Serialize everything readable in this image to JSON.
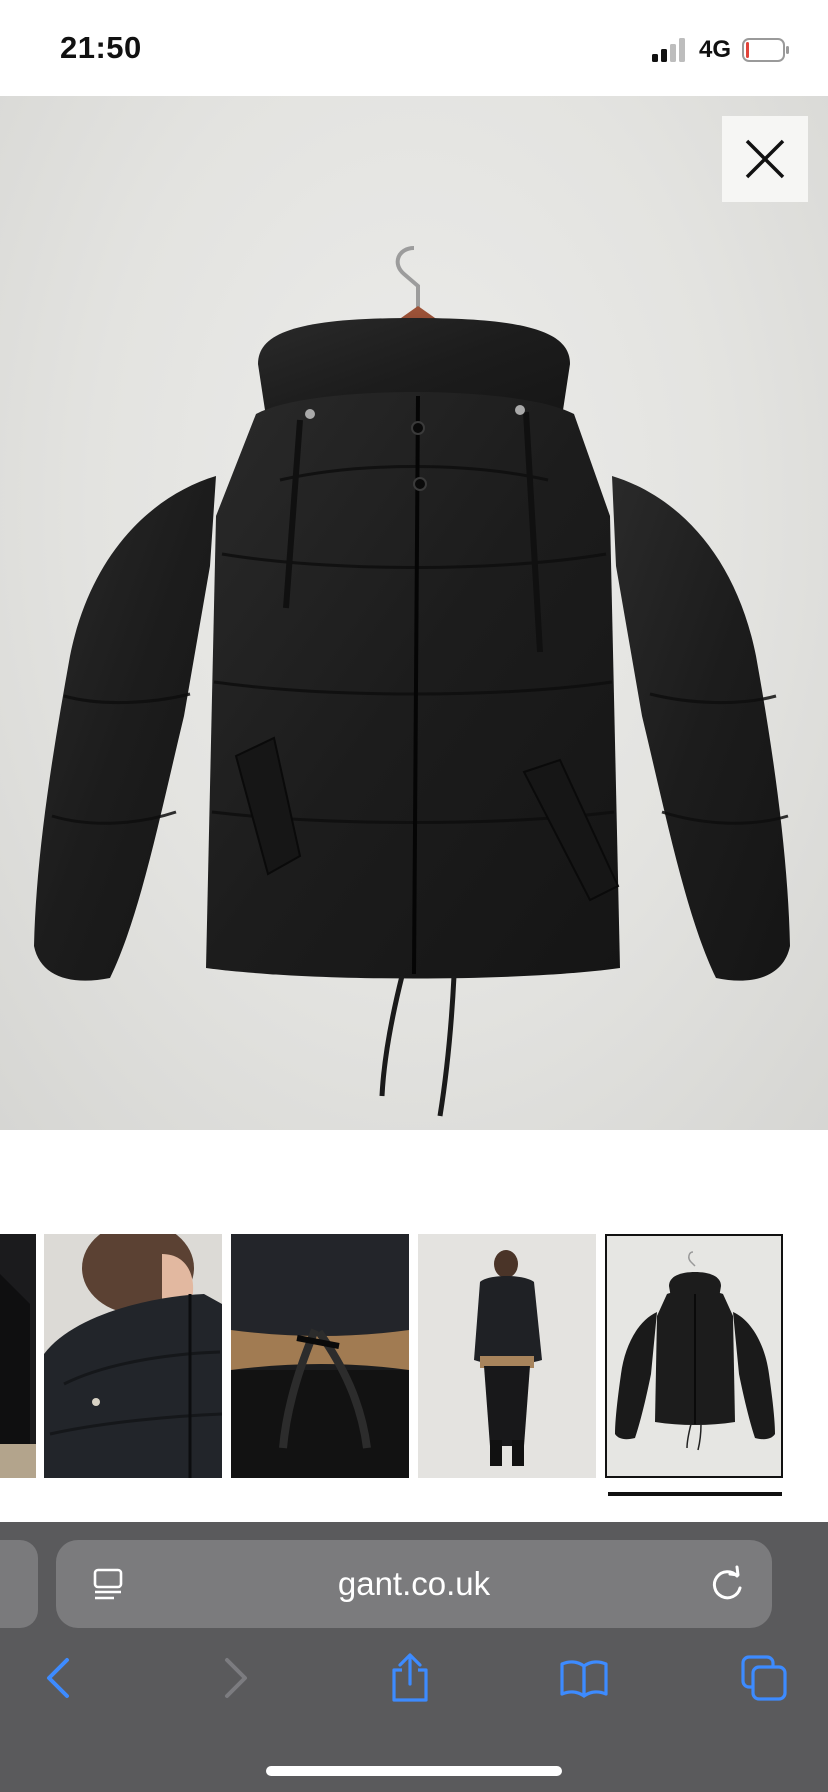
{
  "status_bar": {
    "time": "21:50",
    "network": "4G",
    "battery_level": 0.05,
    "battery_color": "#e0433a"
  },
  "product_gallery": {
    "main_image": "black-hooded-puffer-jacket-on-hanger",
    "close_icon": "close-icon",
    "thumbnails": [
      {
        "subject": "jacket-detail-cropped"
      },
      {
        "subject": "model-collar-closeup"
      },
      {
        "subject": "drawstring-hem-detail"
      },
      {
        "subject": "model-full-length"
      },
      {
        "subject": "jacket-on-hanger",
        "selected": true
      }
    ],
    "selected_index": 4
  },
  "browser": {
    "url": "gant.co.uk",
    "reader_icon": "reader-mode-icon",
    "reload_icon": "reload-icon",
    "toolbar": [
      {
        "name": "back",
        "icon": "chevron-left-icon",
        "enabled": true
      },
      {
        "name": "forward",
        "icon": "chevron-right-icon",
        "enabled": false
      },
      {
        "name": "share",
        "icon": "share-icon",
        "enabled": true
      },
      {
        "name": "bookmarks",
        "icon": "book-icon",
        "enabled": true
      },
      {
        "name": "tabs",
        "icon": "tabs-icon",
        "enabled": true
      }
    ],
    "accent_color": "#3d8bff"
  }
}
